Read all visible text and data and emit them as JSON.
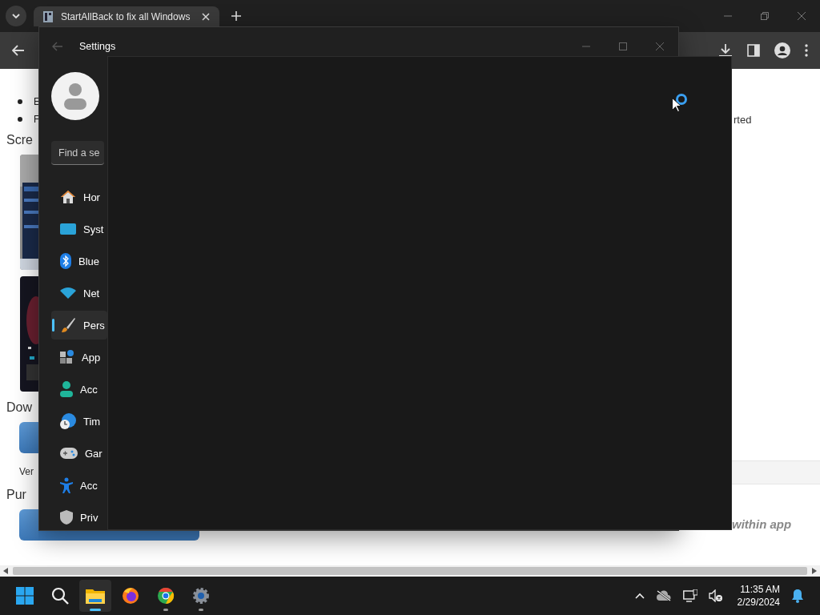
{
  "browser": {
    "tabs": [
      {
        "title": "StartAllBack to fix all Windows",
        "selected": true
      }
    ],
    "page": {
      "bullets": [
        "E",
        "F"
      ],
      "heading_screens": "Scre",
      "heading_download": "Dow",
      "version_label": "Ver",
      "heading_purchase": "Pur",
      "right_text": "rted",
      "right_note": "within app"
    }
  },
  "settings": {
    "title": "Settings",
    "search": {
      "placeholder": "Find a se"
    },
    "loading": true,
    "nav": [
      {
        "label": "Hor",
        "kind": "home",
        "selected": false
      },
      {
        "label": "Syst",
        "kind": "system",
        "selected": false
      },
      {
        "label": "Blue",
        "kind": "bluetooth",
        "selected": false
      },
      {
        "label": "Net",
        "kind": "network",
        "selected": false
      },
      {
        "label": "Pers",
        "kind": "brush",
        "selected": true
      },
      {
        "label": "App",
        "kind": "apps",
        "selected": false
      },
      {
        "label": "Acc",
        "kind": "person",
        "selected": false
      },
      {
        "label": "Tim",
        "kind": "time",
        "selected": false
      },
      {
        "label": "Gar",
        "kind": "gamepad",
        "selected": false
      },
      {
        "label": "Acc",
        "kind": "accessibility",
        "selected": false
      },
      {
        "label": "Priv",
        "kind": "shield",
        "selected": false
      }
    ]
  },
  "taskbar": {
    "apps": [
      {
        "kind": "start",
        "open": false,
        "focused": false
      },
      {
        "kind": "search",
        "open": false,
        "focused": false
      },
      {
        "kind": "folder",
        "open": true,
        "focused": true
      },
      {
        "kind": "firefox",
        "open": false,
        "focused": false
      },
      {
        "kind": "chrome",
        "open": true,
        "focused": false
      },
      {
        "kind": "gear",
        "open": true,
        "focused": false
      }
    ],
    "time": "11:35 AM",
    "date": "2/29/2024"
  }
}
